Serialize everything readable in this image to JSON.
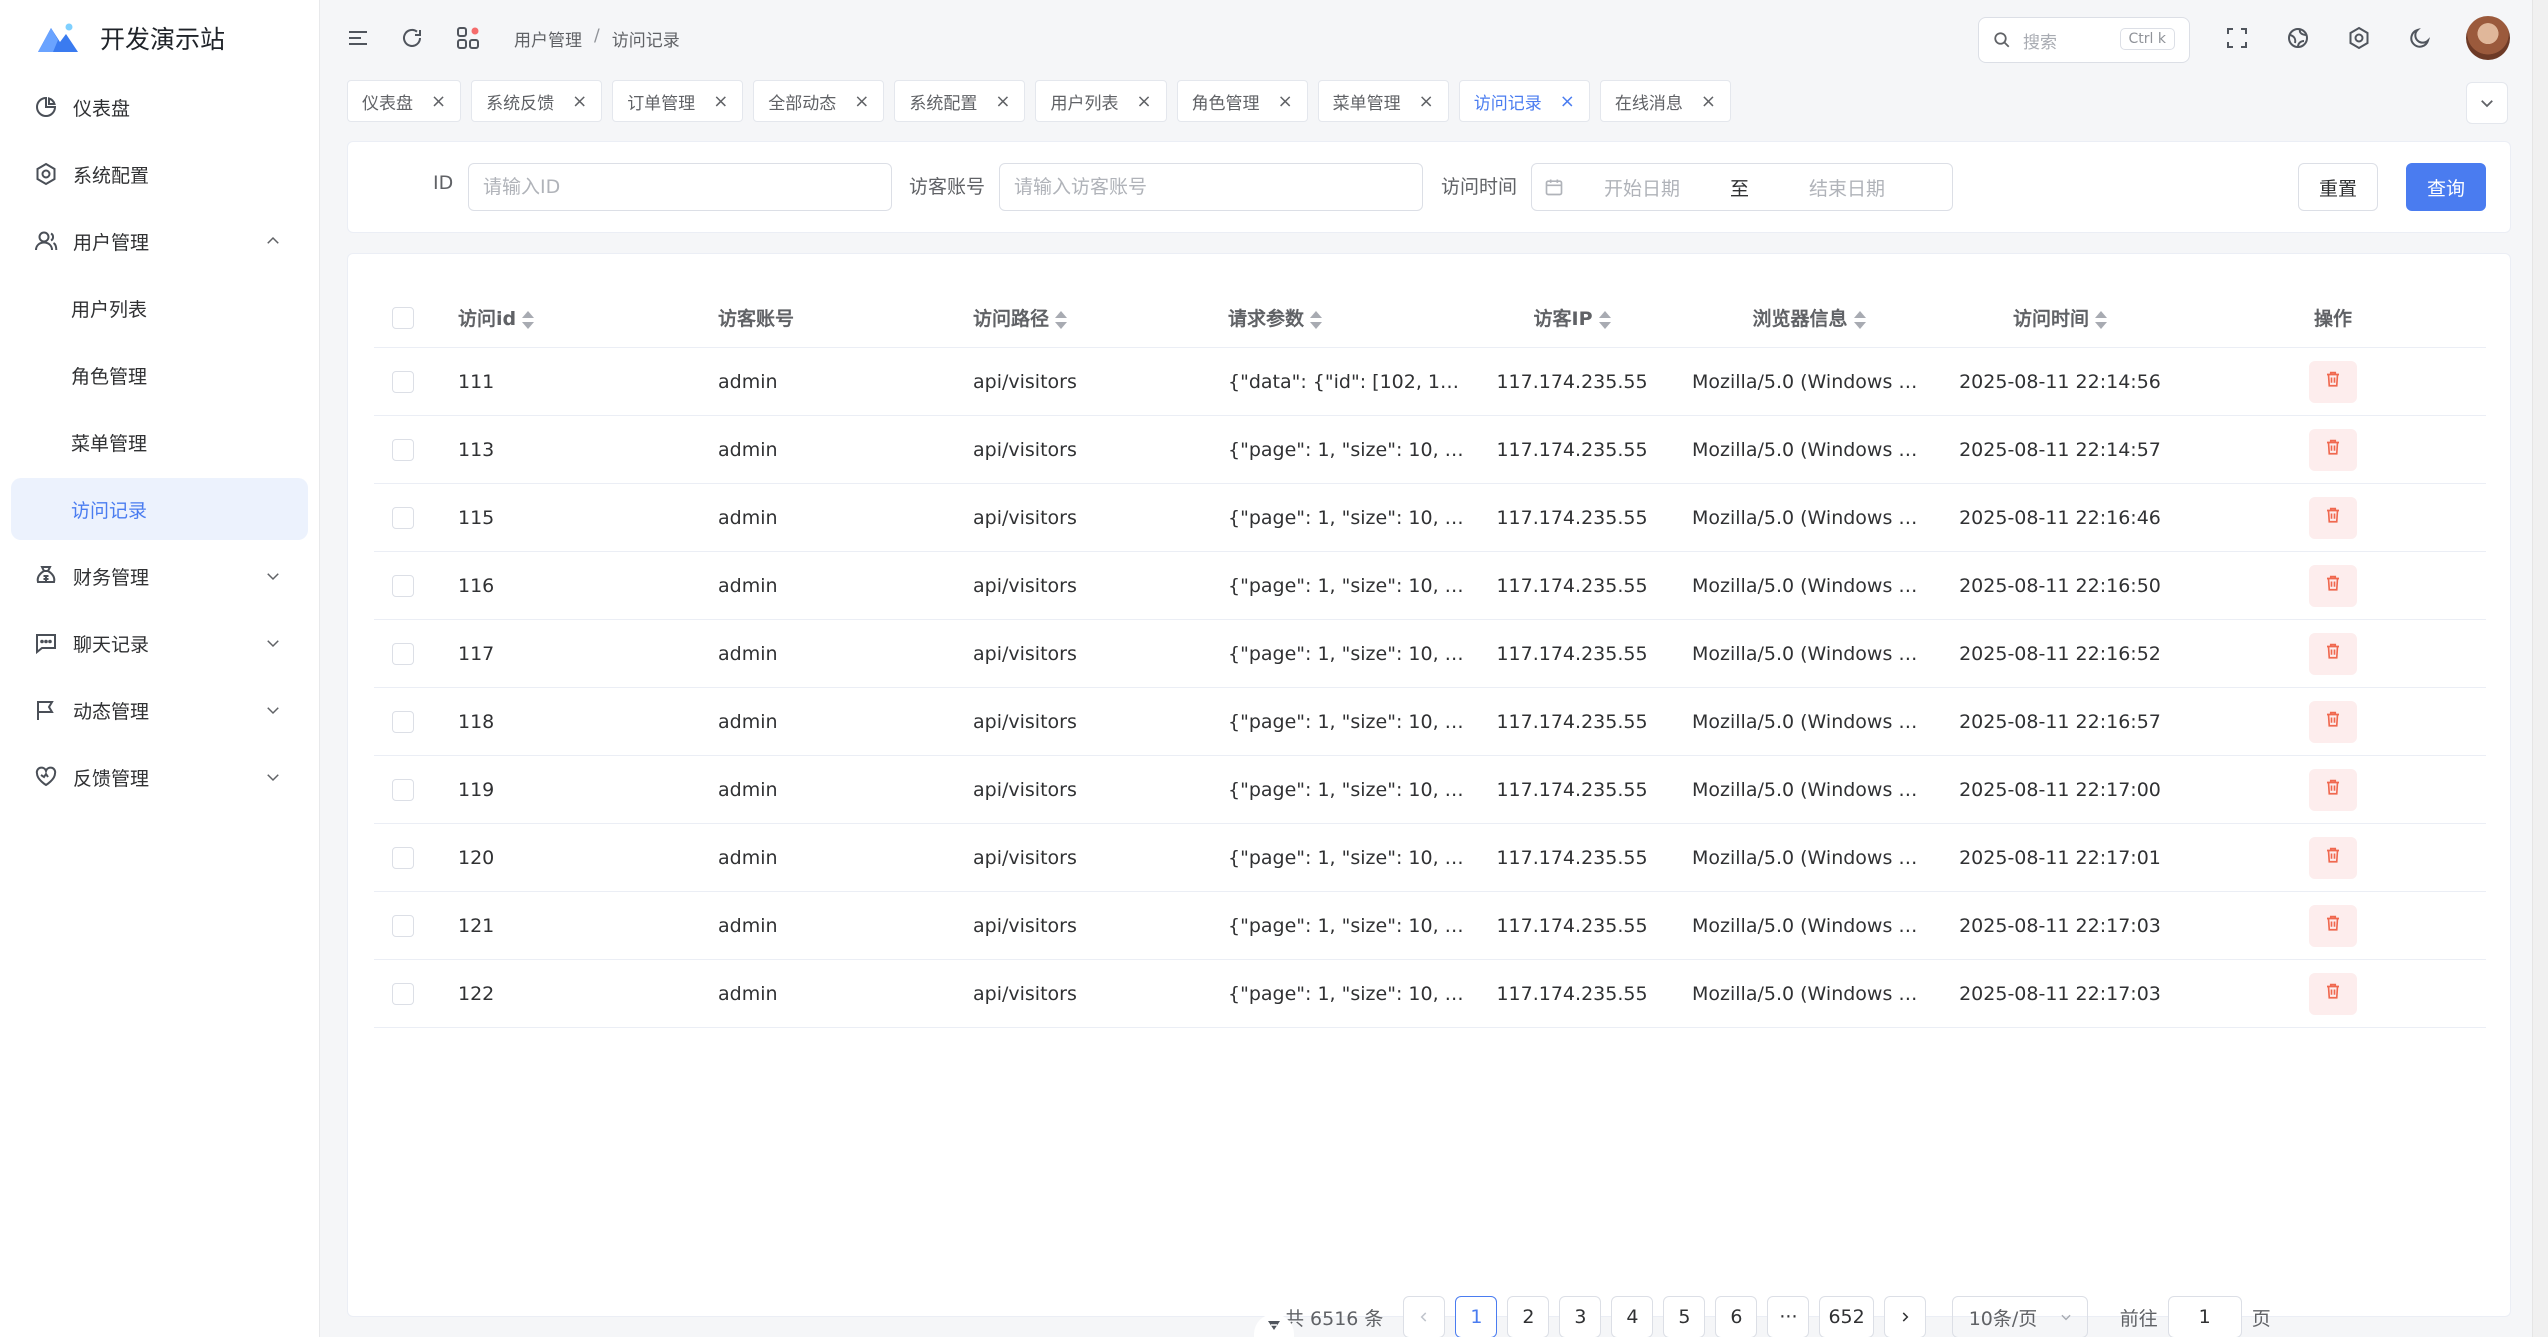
{
  "brand": {
    "title": "开发演示站"
  },
  "sidebar": {
    "items": [
      {
        "label": "仪表盘",
        "icon": "dashboard-icon"
      },
      {
        "label": "系统配置",
        "icon": "gear-icon"
      },
      {
        "label": "用户管理",
        "icon": "user-icon",
        "expanded": true
      },
      {
        "label": "用户列表",
        "sub": true
      },
      {
        "label": "角色管理",
        "sub": true
      },
      {
        "label": "菜单管理",
        "sub": true
      },
      {
        "label": "访问记录",
        "sub": true,
        "active": true
      },
      {
        "label": "财务管理",
        "icon": "finance-icon"
      },
      {
        "label": "聊天记录",
        "icon": "chat-icon"
      },
      {
        "label": "动态管理",
        "icon": "flag-icon"
      },
      {
        "label": "反馈管理",
        "icon": "heart-icon"
      }
    ]
  },
  "header": {
    "breadcrumb": [
      "用户管理",
      "访问记录"
    ],
    "breadcrumb_sep": "/",
    "search_placeholder": "搜索",
    "search_shortcut": "Ctrl k"
  },
  "tabs": [
    {
      "label": "仪表盘"
    },
    {
      "label": "系统反馈"
    },
    {
      "label": "订单管理"
    },
    {
      "label": "全部动态"
    },
    {
      "label": "系统配置"
    },
    {
      "label": "用户列表"
    },
    {
      "label": "角色管理"
    },
    {
      "label": "菜单管理"
    },
    {
      "label": "访问记录",
      "active": true
    },
    {
      "label": "在线消息"
    }
  ],
  "filters": {
    "id_label": "ID",
    "id_placeholder": "请输入ID",
    "account_label": "访客账号",
    "account_placeholder": "请输入访客账号",
    "time_label": "访问时间",
    "start_placeholder": "开始日期",
    "range_sep": "至",
    "end_placeholder": "结束日期",
    "reset_label": "重置",
    "search_label": "查询"
  },
  "table": {
    "headers": {
      "id": "访问id",
      "account": "访客账号",
      "path": "访问路径",
      "params": "请求参数",
      "ip": "访客IP",
      "browser": "浏览器信息",
      "time": "访问时间",
      "op": "操作"
    },
    "rows": [
      {
        "id": "111",
        "account": "admin",
        "path": "api/visitors",
        "params": "{\"data\": {\"id\": [102, 103, …",
        "ip": "117.174.235.55",
        "browser": "Mozilla/5.0 (Windows N…",
        "time": "2025-08-11 22:14:56"
      },
      {
        "id": "113",
        "account": "admin",
        "path": "api/visitors",
        "params": "{\"page\": 1, \"size\": 10, \"ty…",
        "ip": "117.174.235.55",
        "browser": "Mozilla/5.0 (Windows N…",
        "time": "2025-08-11 22:14:57"
      },
      {
        "id": "115",
        "account": "admin",
        "path": "api/visitors",
        "params": "{\"page\": 1, \"size\": 10, \"ty…",
        "ip": "117.174.235.55",
        "browser": "Mozilla/5.0 (Windows N…",
        "time": "2025-08-11 22:16:46"
      },
      {
        "id": "116",
        "account": "admin",
        "path": "api/visitors",
        "params": "{\"page\": 1, \"size\": 10, \"ty…",
        "ip": "117.174.235.55",
        "browser": "Mozilla/5.0 (Windows N…",
        "time": "2025-08-11 22:16:50"
      },
      {
        "id": "117",
        "account": "admin",
        "path": "api/visitors",
        "params": "{\"page\": 1, \"size\": 10, \"ty…",
        "ip": "117.174.235.55",
        "browser": "Mozilla/5.0 (Windows N…",
        "time": "2025-08-11 22:16:52"
      },
      {
        "id": "118",
        "account": "admin",
        "path": "api/visitors",
        "params": "{\"page\": 1, \"size\": 10, \"ty…",
        "ip": "117.174.235.55",
        "browser": "Mozilla/5.0 (Windows N…",
        "time": "2025-08-11 22:16:57"
      },
      {
        "id": "119",
        "account": "admin",
        "path": "api/visitors",
        "params": "{\"page\": 1, \"size\": 10, \"ty…",
        "ip": "117.174.235.55",
        "browser": "Mozilla/5.0 (Windows N…",
        "time": "2025-08-11 22:17:00"
      },
      {
        "id": "120",
        "account": "admin",
        "path": "api/visitors",
        "params": "{\"page\": 1, \"size\": 10, \"ty…",
        "ip": "117.174.235.55",
        "browser": "Mozilla/5.0 (Windows N…",
        "time": "2025-08-11 22:17:01"
      },
      {
        "id": "121",
        "account": "admin",
        "path": "api/visitors",
        "params": "{\"page\": 1, \"size\": 10, \"ty…",
        "ip": "117.174.235.55",
        "browser": "Mozilla/5.0 (Windows N…",
        "time": "2025-08-11 22:17:03"
      },
      {
        "id": "122",
        "account": "admin",
        "path": "api/visitors",
        "params": "{\"page\": 1, \"size\": 10, \"ty…",
        "ip": "117.174.235.55",
        "browser": "Mozilla/5.0 (Windows N…",
        "time": "2025-08-11 22:17:03"
      }
    ]
  },
  "pagination": {
    "total_text": "共 6516 条",
    "pages": [
      "1",
      "2",
      "3",
      "4",
      "5",
      "6",
      "···",
      "652"
    ],
    "current": "1",
    "page_size": "10条/页",
    "goto_label": "前往",
    "goto_value": "1",
    "goto_suffix": "页"
  },
  "colors": {
    "accent": "#4a7cf0",
    "danger": "#f0684f",
    "active_bg": "#ecf2fd"
  }
}
